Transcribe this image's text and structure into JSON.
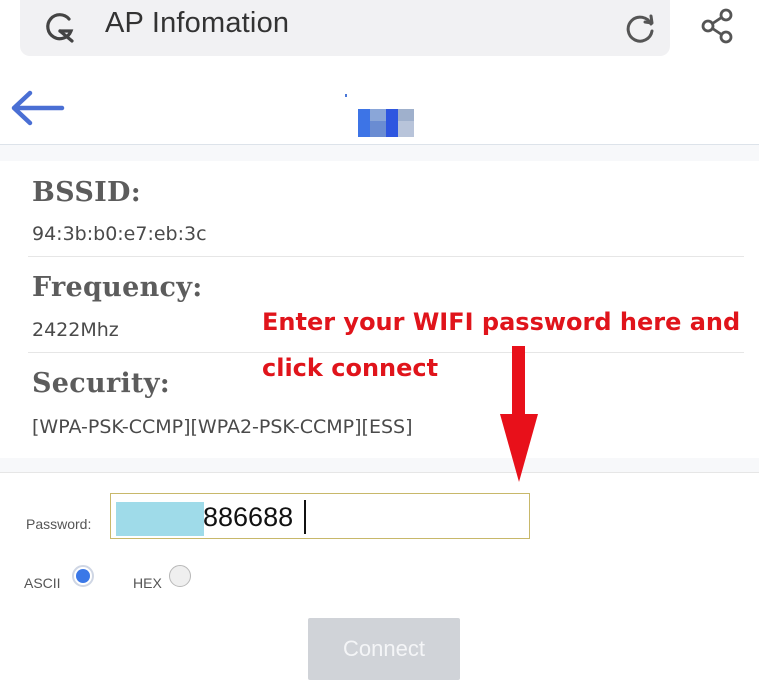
{
  "browser": {
    "title": "AP Infomation",
    "icons": [
      "g-icon",
      "reload-icon",
      "share-icon"
    ]
  },
  "nav": {
    "back_icon": "arrow-left-icon",
    "accent": "#4a6fd4"
  },
  "info": {
    "bssid_label": "BSSID:",
    "bssid_value": "94:3b:b0:e7:eb:3c",
    "frequency_label": "Frequency:",
    "frequency_value": "2422Mhz",
    "security_label": "Security:",
    "security_value": "[WPA-PSK-CCMP][WPA2-PSK-CCMP][ESS]"
  },
  "annotation": {
    "line1": "Enter your WIFI password here and",
    "line2": "click connect",
    "color": "#e0141b"
  },
  "form": {
    "password_label": "Password:",
    "password_value": "886688",
    "ascii_label": "ASCII",
    "hex_label": "HEX",
    "ascii_selected": true,
    "hex_selected": false,
    "connect_label": "Connect"
  }
}
